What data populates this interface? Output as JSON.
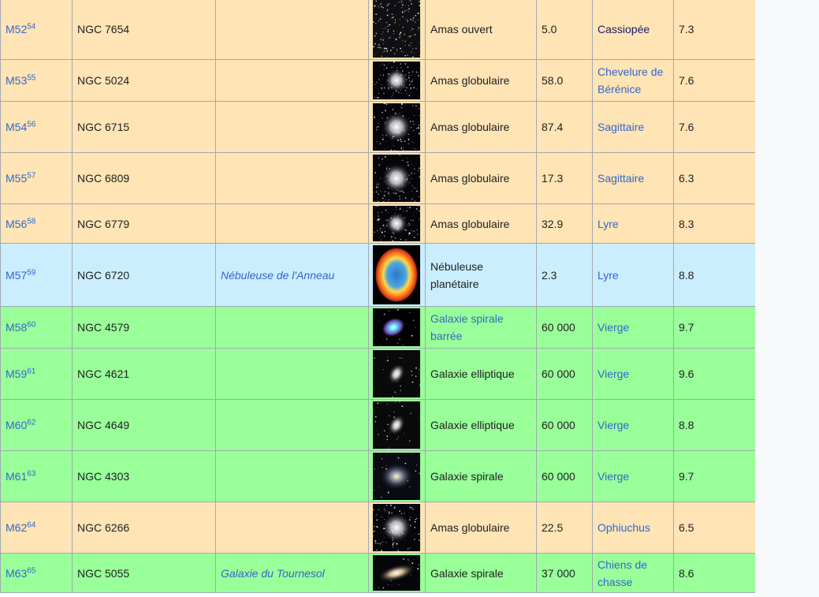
{
  "colors": {
    "open_cluster_bg": "#ffe4b5",
    "globular_bg": "#ffe4b5",
    "nebula_bg": "#cbeeff",
    "galaxy_bg": "#99ff99",
    "link": "#3366cc",
    "visited_link": "#1b1b6b",
    "border": "#a2a9b1"
  },
  "rows": [
    {
      "messier": "M52",
      "ref": "54",
      "ngc": "NGC 7654",
      "name": "",
      "type": "Amas ouvert",
      "type_link": false,
      "distance": "5.0",
      "constellation": "Cassiopée",
      "constellation_visited": true,
      "magnitude": "7.3",
      "thumb": "open-cluster-image",
      "category": "open"
    },
    {
      "messier": "M53",
      "ref": "55",
      "ngc": "NGC 5024",
      "name": "",
      "type": "Amas globulaire",
      "type_link": false,
      "distance": "58.0",
      "constellation": "Chevelure de Bérénice",
      "constellation_visited": false,
      "magnitude": "7.6",
      "thumb": "globular-cluster-image",
      "category": "globular"
    },
    {
      "messier": "M54",
      "ref": "56",
      "ngc": "NGC 6715",
      "name": "",
      "type": "Amas globulaire",
      "type_link": false,
      "distance": "87.4",
      "constellation": "Sagittaire",
      "constellation_visited": false,
      "magnitude": "7.6",
      "thumb": "globular-cluster-image",
      "category": "globular"
    },
    {
      "messier": "M55",
      "ref": "57",
      "ngc": "NGC 6809",
      "name": "",
      "type": "Amas globulaire",
      "type_link": false,
      "distance": "17.3",
      "constellation": "Sagittaire",
      "constellation_visited": false,
      "magnitude": "6.3",
      "thumb": "globular-cluster-image",
      "category": "globular"
    },
    {
      "messier": "M56",
      "ref": "58",
      "ngc": "NGC 6779",
      "name": "",
      "type": "Amas globulaire",
      "type_link": false,
      "distance": "32.9",
      "constellation": "Lyre",
      "constellation_visited": false,
      "magnitude": "8.3",
      "thumb": "globular-cluster-image",
      "category": "globular"
    },
    {
      "messier": "M57",
      "ref": "59",
      "ngc": "NGC 6720",
      "name": "Nébuleuse de l'Anneau",
      "type": "Nébuleuse planétaire",
      "type_link": false,
      "distance": "2.3",
      "constellation": "Lyre",
      "constellation_visited": false,
      "magnitude": "8.8",
      "thumb": "ring-nebula-image",
      "category": "nebula"
    },
    {
      "messier": "M58",
      "ref": "60",
      "ngc": "NGC 4579",
      "name": "",
      "type": "Galaxie spirale barrée",
      "type_link": true,
      "distance": "60 000",
      "constellation": "Vierge",
      "constellation_visited": false,
      "magnitude": "9.7",
      "thumb": "barred-spiral-image",
      "category": "galaxy"
    },
    {
      "messier": "M59",
      "ref": "61",
      "ngc": "NGC 4621",
      "name": "",
      "type": "Galaxie elliptique",
      "type_link": false,
      "distance": "60 000",
      "constellation": "Vierge",
      "constellation_visited": false,
      "magnitude": "9.6",
      "thumb": "elliptical-galaxy-image",
      "category": "galaxy"
    },
    {
      "messier": "M60",
      "ref": "62",
      "ngc": "NGC 4649",
      "name": "",
      "type": "Galaxie elliptique",
      "type_link": false,
      "distance": "60 000",
      "constellation": "Vierge",
      "constellation_visited": false,
      "magnitude": "8.8",
      "thumb": "elliptical-galaxy-image",
      "category": "galaxy"
    },
    {
      "messier": "M61",
      "ref": "63",
      "ngc": "NGC 4303",
      "name": "",
      "type": "Galaxie spirale",
      "type_link": false,
      "distance": "60 000",
      "constellation": "Vierge",
      "constellation_visited": false,
      "magnitude": "9.7",
      "thumb": "spiral-galaxy-image",
      "category": "galaxy"
    },
    {
      "messier": "M62",
      "ref": "64",
      "ngc": "NGC 6266",
      "name": "",
      "type": "Amas globulaire",
      "type_link": false,
      "distance": "22.5",
      "constellation": "Ophiuchus",
      "constellation_visited": false,
      "magnitude": "6.5",
      "thumb": "globular-cluster-image",
      "category": "globular"
    },
    {
      "messier": "M63",
      "ref": "65",
      "ngc": "NGC 5055",
      "name": "Galaxie du Tournesol",
      "type": "Galaxie spirale",
      "type_link": false,
      "distance": "37 000",
      "constellation": "Chiens de chasse",
      "constellation_visited": false,
      "magnitude": "8.6",
      "thumb": "sunflower-galaxy-image",
      "category": "galaxy"
    }
  ]
}
